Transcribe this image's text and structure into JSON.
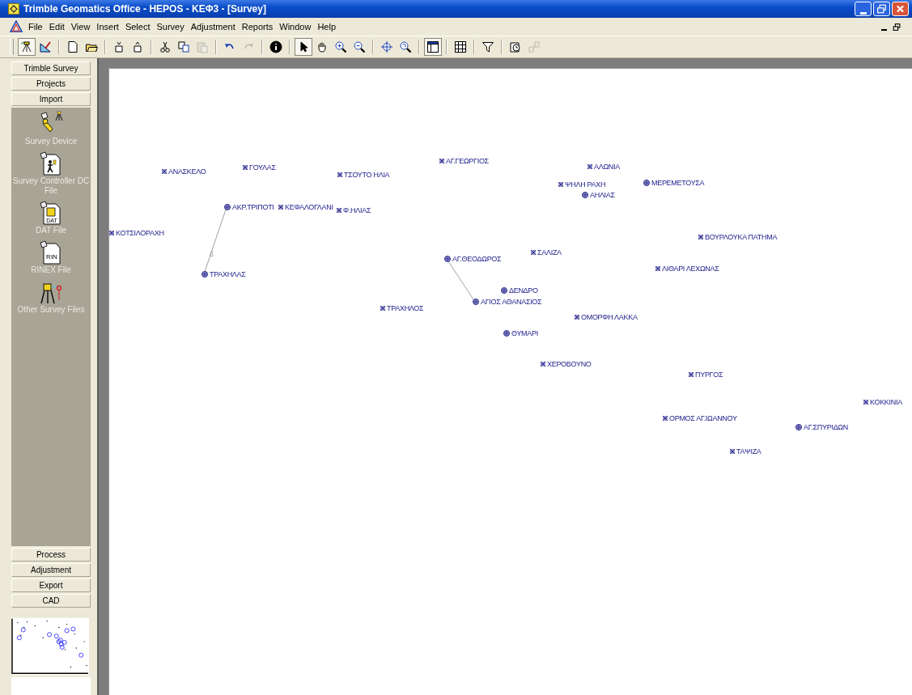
{
  "window": {
    "title": "Trimble Geomatics Office - HEPOS - ΚΕΦ3 - [Survey]"
  },
  "menu": [
    {
      "label": "File"
    },
    {
      "label": "Edit"
    },
    {
      "label": "View"
    },
    {
      "label": "Insert"
    },
    {
      "label": "Select"
    },
    {
      "label": "Survey"
    },
    {
      "label": "Adjustment"
    },
    {
      "label": "Reports"
    },
    {
      "label": "Window"
    },
    {
      "label": "Help"
    }
  ],
  "toolbar": [
    [
      {
        "kind": "survey-view",
        "selected": true,
        "disabled": false
      },
      {
        "kind": "cad-view",
        "selected": false,
        "disabled": false
      }
    ],
    [
      {
        "kind": "new",
        "selected": false,
        "disabled": false
      },
      {
        "kind": "open",
        "selected": false,
        "disabled": false
      }
    ],
    [
      {
        "kind": "import",
        "selected": false,
        "disabled": false
      },
      {
        "kind": "export",
        "selected": false,
        "disabled": false
      }
    ],
    [
      {
        "kind": "cut",
        "selected": false,
        "disabled": false
      },
      {
        "kind": "copy",
        "selected": false,
        "disabled": false
      },
      {
        "kind": "paste",
        "selected": false,
        "disabled": true
      }
    ],
    [
      {
        "kind": "undo",
        "selected": false,
        "disabled": false
      },
      {
        "kind": "redo",
        "selected": false,
        "disabled": true
      }
    ],
    [
      {
        "kind": "info",
        "selected": false,
        "disabled": false
      }
    ],
    [
      {
        "kind": "pointer",
        "selected": true,
        "disabled": false
      },
      {
        "kind": "pan",
        "selected": false,
        "disabled": false
      },
      {
        "kind": "zoom-in",
        "selected": false,
        "disabled": false
      },
      {
        "kind": "zoom-out",
        "selected": false,
        "disabled": false
      }
    ],
    [
      {
        "kind": "zoom-extents",
        "selected": false,
        "disabled": false
      },
      {
        "kind": "zoom-previous",
        "selected": false,
        "disabled": false
      }
    ],
    [
      {
        "kind": "panel",
        "selected": true,
        "disabled": false
      }
    ],
    [
      {
        "kind": "grid",
        "selected": false,
        "disabled": false
      }
    ],
    [
      {
        "kind": "filter",
        "selected": false,
        "disabled": false
      }
    ],
    [
      {
        "kind": "timeline",
        "selected": false,
        "disabled": false
      },
      {
        "kind": "network",
        "selected": false,
        "disabled": true
      }
    ]
  ],
  "sidebar": {
    "top_sections": [
      {
        "label": "Trimble Survey"
      },
      {
        "label": "Projects"
      },
      {
        "label": "Import"
      }
    ],
    "items": [
      {
        "label": "Survey Device",
        "kind": "device"
      },
      {
        "label": "Survey Controller DC File",
        "kind": "dc"
      },
      {
        "label": "DAT File",
        "kind": "dat",
        "tag": "DAT"
      },
      {
        "label": "RINEX File",
        "kind": "rinex",
        "tag": "RIN"
      },
      {
        "label": "Other Survey Files",
        "kind": "other"
      }
    ],
    "bottom_sections": [
      {
        "label": "Process"
      },
      {
        "label": "Adjustment"
      },
      {
        "label": "Export"
      },
      {
        "label": "CAD"
      }
    ]
  },
  "points": [
    {
      "name": "ΑΝΑΣΚΕΛΟ",
      "kind": "point"
    },
    {
      "name": "ΓΟΥΛΑΣ",
      "kind": "point"
    },
    {
      "name": "ΤΣΟΥΤΟ ΗΛΙΑ",
      "kind": "point"
    },
    {
      "name": "ΑΓ.ΓΕΩΡΓΙΟΣ",
      "kind": "point"
    },
    {
      "name": "ΑΛΩΝΙΑ",
      "kind": "point"
    },
    {
      "name": "ΨΗΛΗ ΡΑΧΗ",
      "kind": "point"
    },
    {
      "name": "ΑΗΛΙΑΣ",
      "kind": "control"
    },
    {
      "name": "ΜΕΡΕΜΕΤΟΥΣΑ",
      "kind": "control"
    },
    {
      "name": "ΑΚΡ.ΤΡΙΠΟΤΙ",
      "kind": "control"
    },
    {
      "name": "ΚΕΦΑΛΟΓΛΑΝΙ",
      "kind": "point"
    },
    {
      "name": "Φ.ΗΛΙΑΣ",
      "kind": "point"
    },
    {
      "name": "ΚΟΤΣΙΛΟΡΑΧΗ",
      "kind": "point"
    },
    {
      "name": "ΒΟΥΡΛΟΥΚΑ ΠΑΤΗΜΑ",
      "kind": "point"
    },
    {
      "name": "ΣΑΛΙΖΑ",
      "kind": "point"
    },
    {
      "name": "ΑΓ.ΘΕΟΔΩΡΟΣ",
      "kind": "control"
    },
    {
      "name": "ΛΙΘΑΡΙ ΛΕΧΩΝΑΣ",
      "kind": "point"
    },
    {
      "name": "ΤΡΑΧΗΛΑΣ",
      "kind": "control"
    },
    {
      "name": "ΔΕΝΔΡΟ",
      "kind": "control"
    },
    {
      "name": "ΑΓΙΟΣ ΑΘΑΝΑΣΙΟΣ",
      "kind": "control"
    },
    {
      "name": "ΤΡΑΧΗΛΟΣ",
      "kind": "point"
    },
    {
      "name": "ΟΜΟΡΦΗ ΛΑΚΚΑ",
      "kind": "point"
    },
    {
      "name": "ΘΥΜΑΡΙ",
      "kind": "control"
    },
    {
      "name": "ΧΕΡΟΒΟΥΝΟ",
      "kind": "point"
    },
    {
      "name": "ΠΥΡΓΟΣ",
      "kind": "point"
    },
    {
      "name": "ΚΟΚΚΙΝΙΑ",
      "kind": "point"
    },
    {
      "name": "ΟΡΜΟΣ ΑΓ.ΙΩΑΝΝΟΥ",
      "kind": "point"
    },
    {
      "name": "ΑΓ.ΣΠΥΡΙΔΩΝ",
      "kind": "control"
    },
    {
      "name": "ΤΑΨΙΖΑ",
      "kind": "point"
    }
  ]
}
